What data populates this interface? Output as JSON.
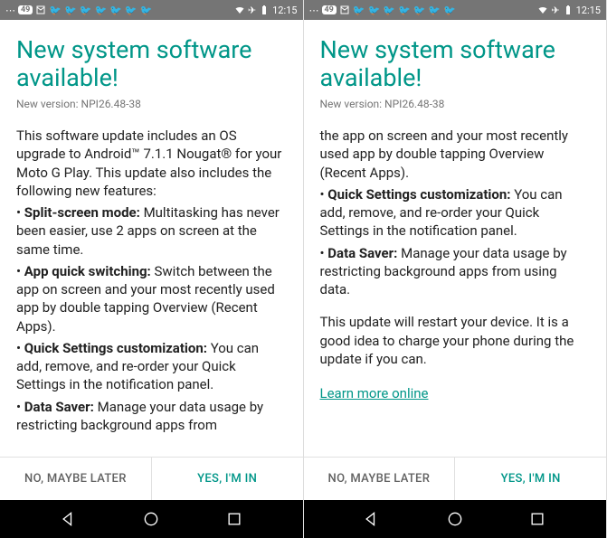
{
  "status": {
    "badge": "49",
    "time": "12:15"
  },
  "dialog": {
    "title": "New system software available!",
    "version": "New version: NPI26.48-38",
    "intro": "This software update includes an OS upgrade to Android™ 7.1.1 Nougat® for your Moto G Play. This update also includes the following new features:",
    "f1_label": "Split-screen mode:",
    "f1_text": " Multitasking has never been easier, use 2 apps on screen at the same time.",
    "f2_label": "App quick switching:",
    "f2_text": " Switch between the app on screen and your most recently used app by double tapping Overview (Recent Apps).",
    "f3_label": "Quick Settings customization:",
    "f3_text": " You can add, remove, and re-order your Quick Settings in the notification panel.",
    "f4_label": "Data Saver:",
    "f4_text_a": " Manage your data usage by restricting background apps from",
    "f4_text_b": " Manage your data usage by restricting background apps from using data.",
    "r2_cont": "the app on screen and your most recently used app by double tapping Overview (Recent Apps).",
    "outro": "This update will restart your device. It is a good idea to charge your phone during the update if you can.",
    "learn": "Learn more online",
    "btn_neg": "NO, MAYBE LATER",
    "btn_pos": "YES, I'M IN"
  }
}
